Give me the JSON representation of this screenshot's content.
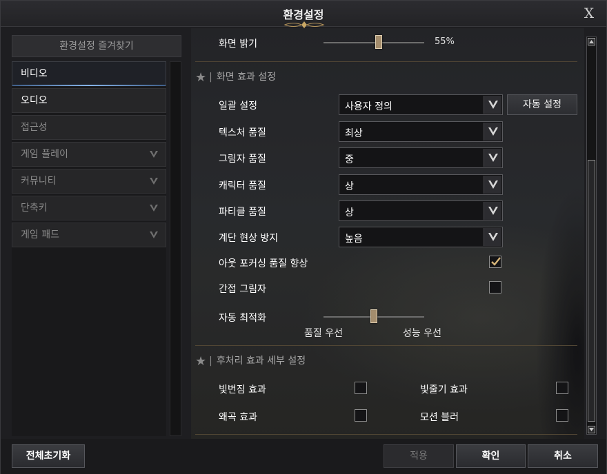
{
  "window": {
    "title": "환경설정",
    "close_label": "X"
  },
  "sidebar": {
    "favorites_label": "환경설정 즐겨찾기",
    "items": [
      {
        "label": "비디오",
        "state": "active",
        "expandable": false
      },
      {
        "label": "오디오",
        "state": "enabled",
        "expandable": false
      },
      {
        "label": "접근성",
        "state": "dim",
        "expandable": false
      },
      {
        "label": "게임 플레이",
        "state": "dim",
        "expandable": true
      },
      {
        "label": "커뮤니티",
        "state": "dim",
        "expandable": true
      },
      {
        "label": "단축키",
        "state": "dim",
        "expandable": true
      },
      {
        "label": "게임 패드",
        "state": "dim",
        "expandable": true
      }
    ]
  },
  "content": {
    "brightness": {
      "label": "화면 밝기",
      "value_text": "55%",
      "value": 0.55
    },
    "effects_section": {
      "title": "화면 효과 설정",
      "bulk": {
        "label": "일괄 설정",
        "value": "사용자 정의",
        "auto_button": "자동 설정"
      },
      "texture": {
        "label": "텍스처 품질",
        "value": "최상"
      },
      "shadow": {
        "label": "그림자 품질",
        "value": "중"
      },
      "character": {
        "label": "캐릭터 품질",
        "value": "상"
      },
      "particle": {
        "label": "파티클 품질",
        "value": "상"
      },
      "antialias": {
        "label": "계단 현상 방지",
        "value": "높음"
      },
      "outfocus": {
        "label": "아웃 포커싱 품질 향상",
        "checked": true
      },
      "indirect_shadow": {
        "label": "간접 그림자",
        "checked": false
      },
      "auto_opt": {
        "label": "자동 최적화",
        "value": 0.5,
        "left_caption": "품질 우선",
        "right_caption": "성능 우선"
      }
    },
    "post_section": {
      "title": "후처리 효과 세부 설정",
      "bloom": {
        "label": "빛번짐 효과",
        "checked": false
      },
      "light_shaft": {
        "label": "빛줄기 효과",
        "checked": false
      },
      "distortion": {
        "label": "왜곡 효과",
        "checked": false
      },
      "motion_blur": {
        "label": "모션 블러",
        "checked": false
      }
    }
  },
  "footer": {
    "reset_label": "전체초기화",
    "apply_label": "적용",
    "confirm_label": "확인",
    "cancel_label": "취소"
  },
  "icons": {
    "star": "★",
    "check": "check-icon",
    "dropdown": "chevron-down-icon"
  },
  "colors": {
    "accent_blue": "#86b3e8",
    "slider_thumb": "#a48d6d",
    "divider_gold": "#514634"
  }
}
